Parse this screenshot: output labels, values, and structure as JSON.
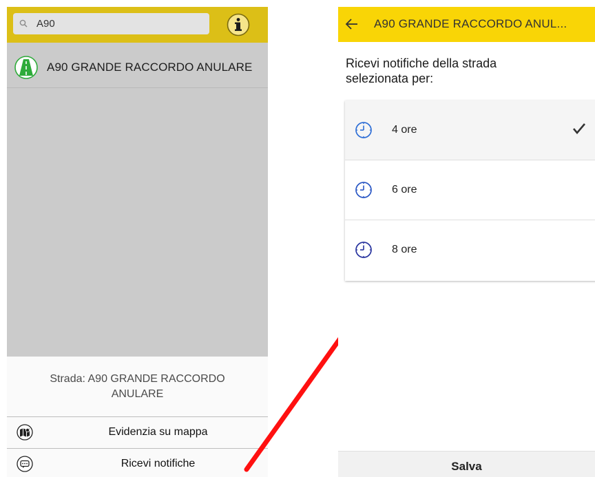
{
  "left": {
    "search": {
      "value": "A90"
    },
    "result": {
      "label": "A90 GRANDE RACCORDO ANULARE"
    },
    "sheet": {
      "title_line1": "Strada: A90 GRANDE RACCORDO",
      "title_line2": "ANULARE",
      "highlight_label": "Evidenzia su mappa",
      "notify_label": "Ricevi notifiche"
    }
  },
  "right": {
    "title": "A90 GRANDE RACCORDO ANUL...",
    "prompt_line1": "Ricevi notifiche della strada",
    "prompt_line2": "selezionata per:",
    "options": [
      {
        "label": "4 ore",
        "selected": true
      },
      {
        "label": "6 ore",
        "selected": false
      },
      {
        "label": "8 ore",
        "selected": false
      }
    ],
    "save_label": "Salva"
  },
  "colors": {
    "left_header": "#dcbf17",
    "right_header": "#f9d506",
    "arrow": "#ff1010",
    "clock": "#2f6fd6"
  },
  "icons": [
    "search-icon",
    "info-icon",
    "road-icon",
    "map-icon",
    "chat-icon",
    "back-arrow-icon",
    "clock-icon",
    "checkmark-icon"
  ]
}
